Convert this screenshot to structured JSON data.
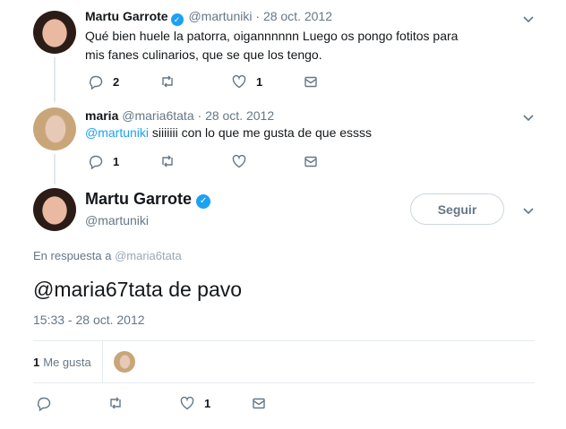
{
  "tweets": [
    {
      "name": "Martu Garrote",
      "verified_glyph": "✓",
      "handle": "@martuniki",
      "separator": "·",
      "date": "28 oct. 2012",
      "text": "Qué bien huele la patorra, oigannnnnn Luego os pongo fotitos para mis fanes culinarios, que se que los tengo.",
      "replies": "2",
      "retweets": "",
      "likes": "1"
    },
    {
      "name": "maria",
      "handle": "@maria6tata",
      "separator": "·",
      "date": "28 oct. 2012",
      "mention": "@martuniki",
      "text": " siiiiiii con lo que me gusta de que essss",
      "replies": "1",
      "retweets": "",
      "likes": ""
    }
  ],
  "main_tweet": {
    "name": "Martu Garrote",
    "verified_glyph": "✓",
    "handle": "@martuniki",
    "follow_label": "Seguir",
    "reply_prefix": "En respuesta a ",
    "reply_to": "@maria6tata",
    "text": "@maria67tata de pavo",
    "timestamp": "15:33 - 28 oct. 2012",
    "likes_count": "1",
    "likes_label": "Me gusta",
    "action_likes": "1"
  },
  "icons": {
    "reply": "reply-icon",
    "retweet": "retweet-icon",
    "like": "heart-icon",
    "dm": "envelope-icon",
    "more": "chevron-down-icon",
    "verified": "verified-badge-icon"
  },
  "colors": {
    "accent": "#1da1f2",
    "muted": "#657786",
    "text": "#14171a",
    "divider": "#e6ecf0"
  }
}
